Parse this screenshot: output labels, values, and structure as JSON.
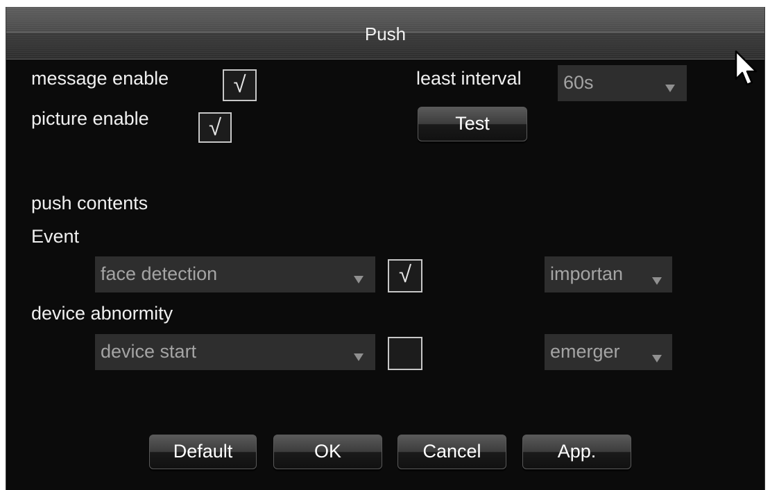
{
  "dialog": {
    "title": "Push"
  },
  "general": {
    "message_enable_label": "message enable",
    "message_enable_checked": true,
    "picture_enable_label": "picture enable",
    "picture_enable_checked": true,
    "least_interval_label": "least interval",
    "least_interval_value": "60s",
    "test_button": "Test"
  },
  "push_contents": {
    "heading": "push contents",
    "event": {
      "label": "Event",
      "type_value": "face detection",
      "enabled": true,
      "level_value": "importan"
    },
    "device_abnormity": {
      "label": "device abnormity",
      "type_value": "device start",
      "enabled": false,
      "level_value": "emerger"
    }
  },
  "footer": {
    "default_button": "Default",
    "ok_button": "OK",
    "cancel_button": "Cancel",
    "apply_button": "App."
  },
  "glyphs": {
    "check": "√"
  },
  "colors": {
    "background": "#0b0b0b",
    "text": "#f0f0f0",
    "field": "#2e2e2e",
    "field_text": "#a4a4a4"
  }
}
